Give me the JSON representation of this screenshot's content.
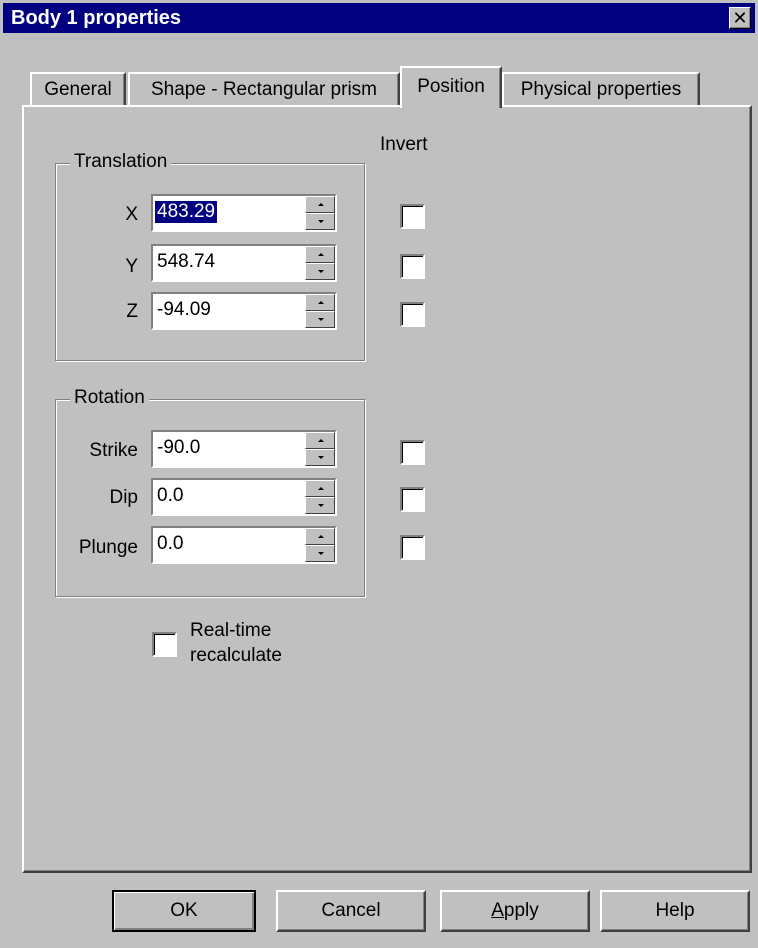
{
  "window": {
    "title": "Body 1 properties",
    "close_glyph": "✕"
  },
  "tabs": [
    {
      "label": "General"
    },
    {
      "label": "Shape - Rectangular prism"
    },
    {
      "label": "Position",
      "active": true
    },
    {
      "label": "Physical properties"
    }
  ],
  "invert_label": "Invert",
  "translation": {
    "label": "Translation",
    "fields": [
      {
        "label": "X",
        "value": "483.29",
        "selected": true,
        "inverted": false
      },
      {
        "label": "Y",
        "value": "548.74",
        "inverted": false
      },
      {
        "label": "Z",
        "value": "-94.09",
        "inverted": false
      }
    ]
  },
  "rotation": {
    "label": "Rotation",
    "fields": [
      {
        "label": "Strike",
        "value": "-90.0",
        "inverted": false
      },
      {
        "label": "Dip",
        "value": "0.0",
        "inverted": false
      },
      {
        "label": "Plunge",
        "value": "0.0",
        "inverted": false
      }
    ]
  },
  "realtime": {
    "line1": "Real-time",
    "line2": "recalculate",
    "checked": false
  },
  "buttons": {
    "ok": "OK",
    "cancel": "Cancel",
    "apply": "Apply",
    "help": "Help"
  },
  "colors": {
    "titlebar": "#000080",
    "face": "#c0c0c0",
    "selection": "#000080"
  }
}
